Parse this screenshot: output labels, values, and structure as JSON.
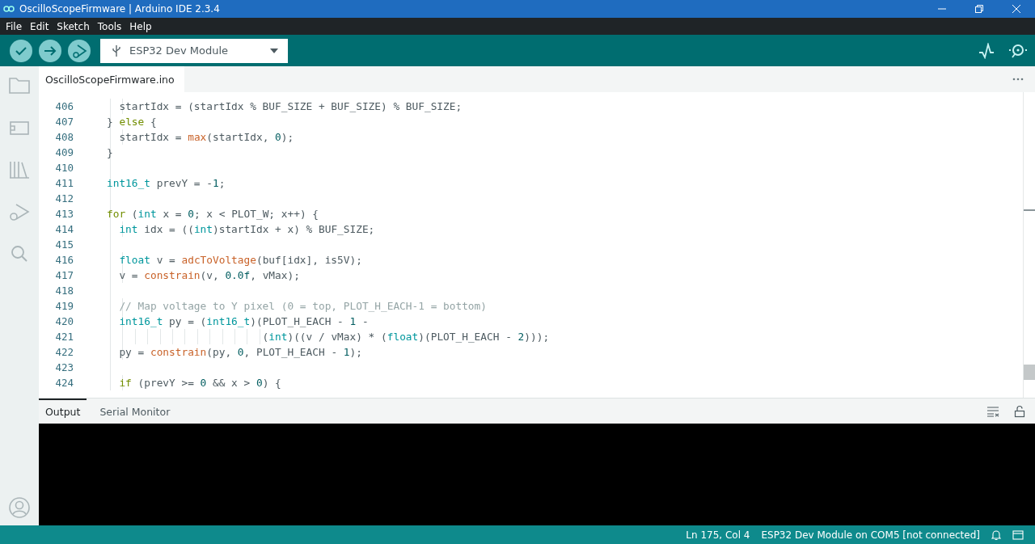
{
  "window": {
    "title": "OscilloScopeFirmware | Arduino IDE 2.3.4"
  },
  "menu": [
    "File",
    "Edit",
    "Sketch",
    "Tools",
    "Help"
  ],
  "board_selector": {
    "value": "ESP32 Dev Module"
  },
  "tabs": [
    {
      "label": "OscilloScopeFirmware.ino",
      "selected": true
    }
  ],
  "editor": {
    "lines": [
      {
        "number": "406",
        "tokens": [
          {
            "t": "  startIdx = (startIdx % BUF_SIZE + BUF_SIZE) % BUF_SIZE;",
            "kind": "plain"
          }
        ]
      },
      {
        "number": "407",
        "tokens": [
          {
            "t": "} ",
            "kind": "plain"
          },
          {
            "t": "else",
            "kind": "control"
          },
          {
            "t": " {",
            "kind": "plain"
          }
        ]
      },
      {
        "number": "408",
        "tokens": [
          {
            "t": "  startIdx = ",
            "kind": "plain"
          },
          {
            "t": "max",
            "kind": "function"
          },
          {
            "t": "(startIdx, ",
            "kind": "plain"
          },
          {
            "t": "0",
            "kind": "number"
          },
          {
            "t": ");",
            "kind": "plain"
          }
        ]
      },
      {
        "number": "409",
        "tokens": [
          {
            "t": "}",
            "kind": "plain"
          }
        ]
      },
      {
        "number": "410"
      },
      {
        "number": "411",
        "tokens": [
          {
            "t": "int16_t",
            "kind": "type"
          },
          {
            "t": " prevY = -",
            "kind": "plain"
          },
          {
            "t": "1",
            "kind": "number"
          },
          {
            "t": ";",
            "kind": "plain"
          }
        ]
      },
      {
        "number": "412"
      },
      {
        "number": "413",
        "tokens": [
          {
            "t": "for",
            "kind": "control"
          },
          {
            "t": " (",
            "kind": "plain"
          },
          {
            "t": "int",
            "kind": "type"
          },
          {
            "t": " x = ",
            "kind": "plain"
          },
          {
            "t": "0",
            "kind": "number"
          },
          {
            "t": "; x < PLOT_W; x++) {",
            "kind": "plain"
          }
        ]
      },
      {
        "number": "414",
        "tokens": [
          {
            "t": "  int",
            "kind": "type"
          },
          {
            "t": " idx = ((",
            "kind": "plain"
          },
          {
            "t": "int",
            "kind": "type"
          },
          {
            "t": ")startIdx + x) % BUF_SIZE;",
            "kind": "plain"
          }
        ]
      },
      {
        "number": "415"
      },
      {
        "number": "416",
        "tokens": [
          {
            "t": "  float",
            "kind": "type"
          },
          {
            "t": " v = ",
            "kind": "plain"
          },
          {
            "t": "adcToVoltage",
            "kind": "function"
          },
          {
            "t": "(buf[idx], is5V);",
            "kind": "plain"
          }
        ]
      },
      {
        "number": "417",
        "tokens": [
          {
            "t": "  v = ",
            "kind": "plain"
          },
          {
            "t": "constrain",
            "kind": "function"
          },
          {
            "t": "(v, ",
            "kind": "plain"
          },
          {
            "t": "0.0f",
            "kind": "number"
          },
          {
            "t": ", vMax);",
            "kind": "plain"
          }
        ]
      },
      {
        "number": "418"
      },
      {
        "number": "419",
        "tokens": [
          {
            "t": "  // Map voltage to Y pixel (0 = top, PLOT_H_EACH-1 = bottom)",
            "kind": "comment"
          }
        ]
      },
      {
        "number": "420",
        "tokens": [
          {
            "t": "  int16_t",
            "kind": "type"
          },
          {
            "t": " py = (",
            "kind": "plain"
          },
          {
            "t": "int16_t",
            "kind": "type"
          },
          {
            "t": ")(PLOT_H_EACH - ",
            "kind": "plain"
          },
          {
            "t": "1",
            "kind": "number"
          },
          {
            "t": " -",
            "kind": "plain"
          }
        ]
      },
      {
        "number": "421",
        "tokens": [
          {
            "t": "                         (",
            "kind": "plain"
          },
          {
            "t": "int",
            "kind": "type"
          },
          {
            "t": ")((v / vMax) * (",
            "kind": "plain"
          },
          {
            "t": "float",
            "kind": "type"
          },
          {
            "t": ")(PLOT_H_EACH - ",
            "kind": "plain"
          },
          {
            "t": "2",
            "kind": "number"
          },
          {
            "t": ")));",
            "kind": "plain"
          }
        ]
      },
      {
        "number": "422",
        "tokens": [
          {
            "t": "  py = ",
            "kind": "plain"
          },
          {
            "t": "constrain",
            "kind": "function"
          },
          {
            "t": "(py, ",
            "kind": "plain"
          },
          {
            "t": "0",
            "kind": "number"
          },
          {
            "t": ", PLOT_H_EACH - ",
            "kind": "plain"
          },
          {
            "t": "1",
            "kind": "number"
          },
          {
            "t": ");",
            "kind": "plain"
          }
        ]
      },
      {
        "number": "423"
      },
      {
        "number": "424",
        "tokens": [
          {
            "t": "  if",
            "kind": "control"
          },
          {
            "t": " (prevY >= ",
            "kind": "plain"
          },
          {
            "t": "0",
            "kind": "number"
          },
          {
            "t": " && x > ",
            "kind": "plain"
          },
          {
            "t": "0",
            "kind": "number"
          },
          {
            "t": ") {",
            "kind": "plain"
          }
        ]
      }
    ]
  },
  "panel": {
    "tabs": [
      {
        "label": "Output",
        "selected": true
      },
      {
        "label": "Serial Monitor",
        "selected": false
      }
    ]
  },
  "status_bar": {
    "position": "Ln 175, Col 4",
    "board": "ESP32 Dev Module on COM5 [not connected]"
  }
}
